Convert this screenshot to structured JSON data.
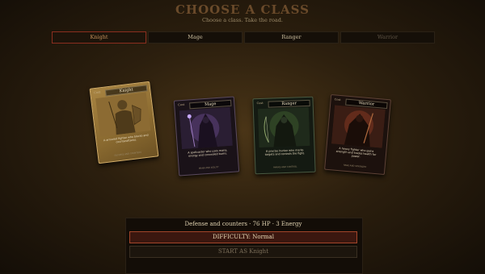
{
  "header": {
    "title": "CHOOSE A CLASS",
    "subtitle": "Choose a class. Take the road."
  },
  "tabs": [
    {
      "label": "Knight",
      "state": "active"
    },
    {
      "label": "Mage",
      "state": "normal"
    },
    {
      "label": "Ranger",
      "state": "normal"
    },
    {
      "label": "Warrior",
      "state": "dim"
    }
  ],
  "cards": [
    {
      "class": "Knight",
      "cost": "Cost",
      "desc": "A armored fighter who blocks and counterattacks.",
      "footer": "DEFENSE AND COUNTERS",
      "selected": true,
      "color": "#b08a4a"
    },
    {
      "class": "Mage",
      "cost": "Cost",
      "desc": "A spellcaster who uses mana, energy and concealed burns.",
      "footer": "MANA AND AGILITY",
      "selected": false,
      "color": "#6a4a8a"
    },
    {
      "class": "Ranger",
      "cost": "Cost",
      "desc": "A precise hunter who marks targets and controls the fight.",
      "footer": "MARKS AND CONTROL",
      "selected": false,
      "color": "#4a6a3a"
    },
    {
      "class": "Warrior",
      "cost": "Cost",
      "desc": "A heavy fighter who gains strength and trades health for power.",
      "footer": "RAGE AND STRENGTH",
      "selected": false,
      "color": "#8a3a2a"
    }
  ],
  "footer": {
    "summary": "Defense and counters · 76 HP · 3 Energy",
    "difficulty": "DIFFICULTY: Normal",
    "start": "START AS Knight"
  },
  "colors": {
    "accent_red": "#a2452a",
    "gold": "#c2905a",
    "background": "#2c1f0e"
  }
}
